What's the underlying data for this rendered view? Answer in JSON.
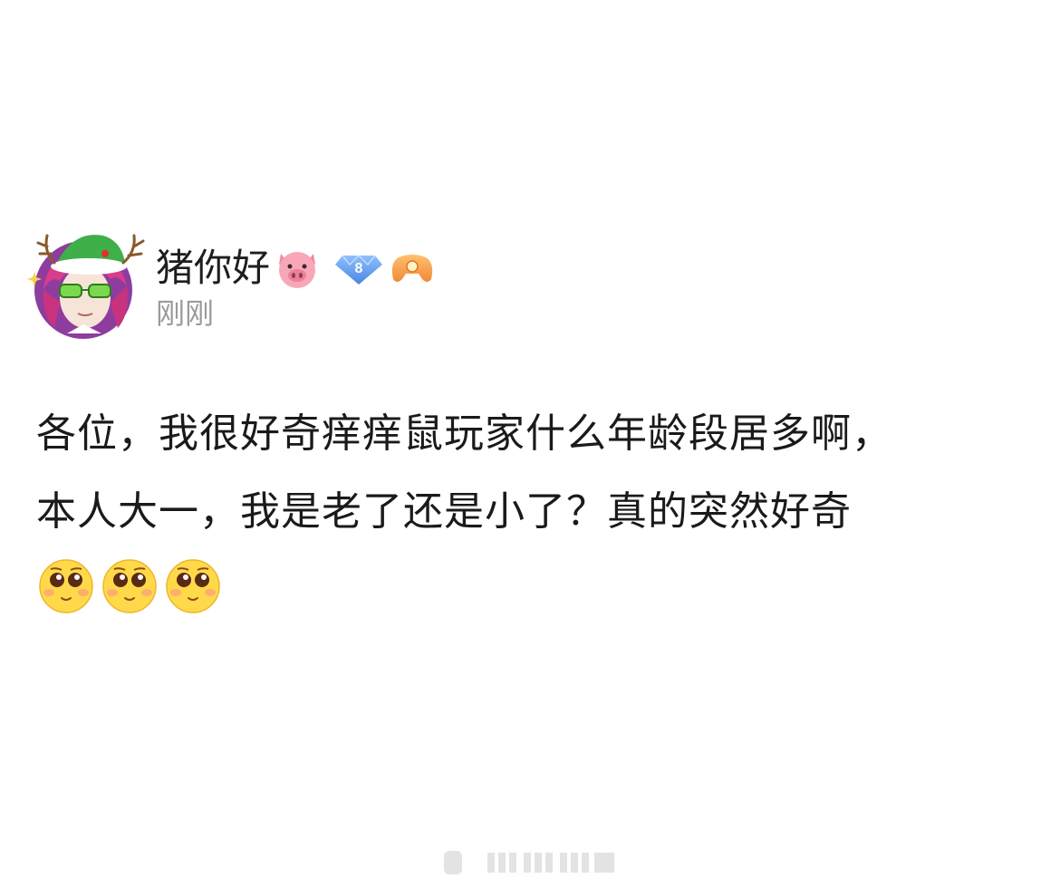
{
  "author": {
    "name": "猪你好",
    "name_emoji_icon": "pig-face-icon",
    "level_badge": {
      "icon": "diamond-level-badge-icon",
      "value": "8",
      "color": "#5b9bea"
    },
    "fan_badge_icon": "game-controller-badge-icon",
    "time": "刚刚"
  },
  "post": {
    "lines": [
      "各位，我很好奇痒痒鼠玩家什么年龄段居多啊，",
      "本人大一，我是老了还是小了？真的突然好奇"
    ],
    "emojis": [
      "pleading-face-icon",
      "pleading-face-icon",
      "pleading-face-icon"
    ]
  },
  "colors": {
    "background": "#ffffff",
    "text": "#1a1a1a",
    "time": "#9a9a9a",
    "avatar_bg": "#8e3d9e"
  }
}
